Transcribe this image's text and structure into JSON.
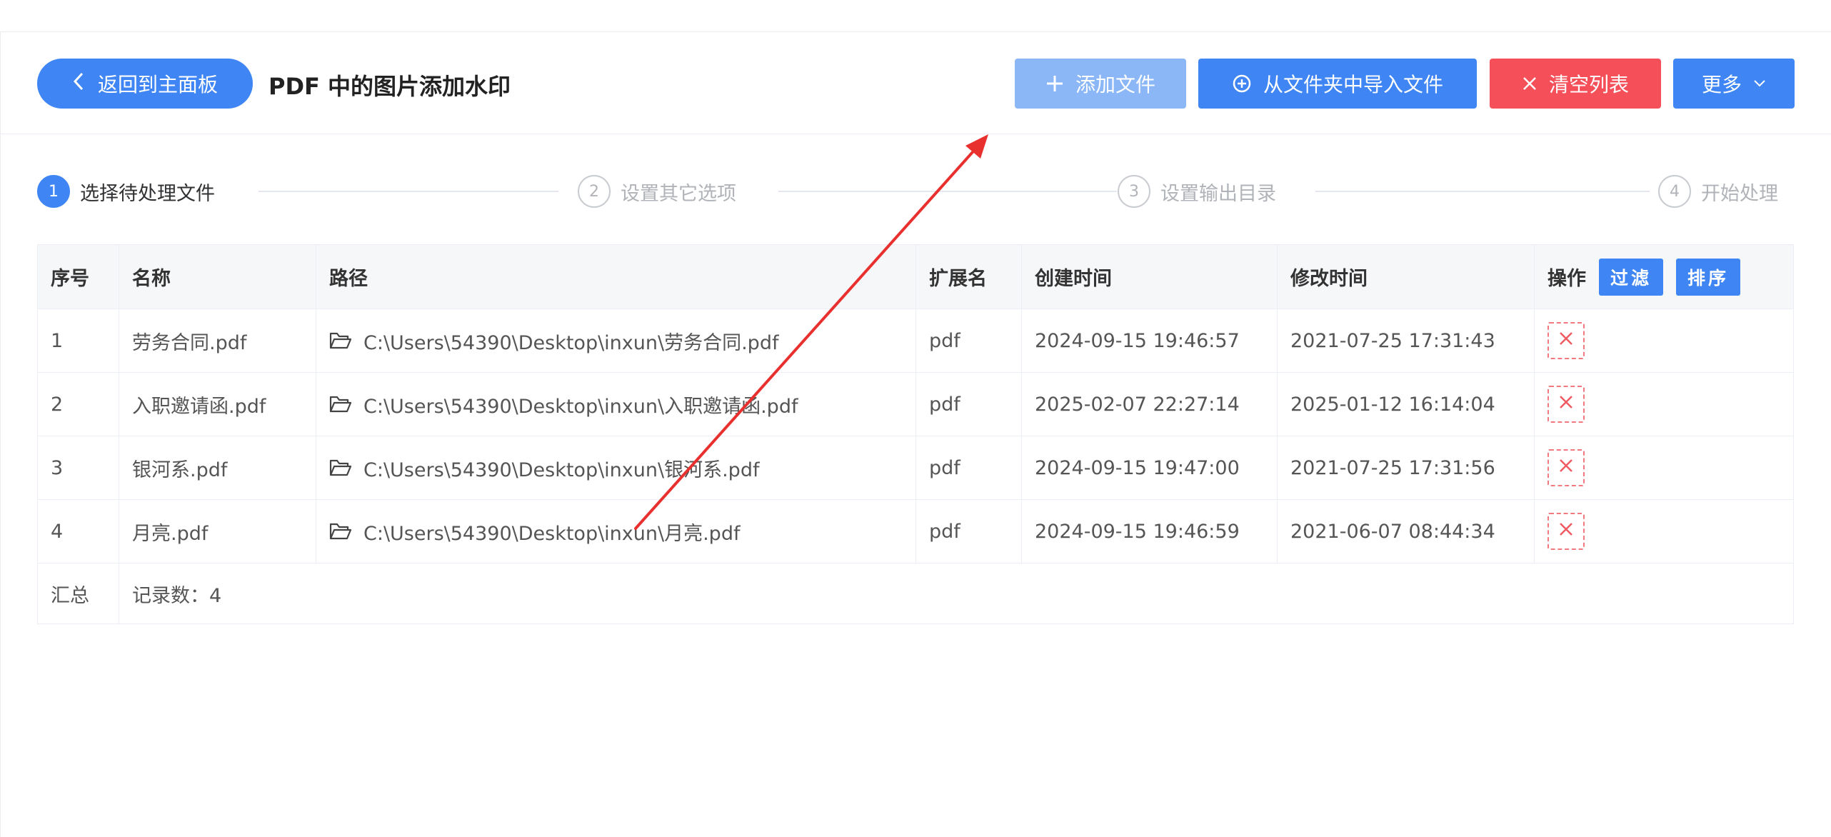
{
  "header": {
    "back_label": "返回到主面板",
    "title": "PDF 中的图片添加水印",
    "add_file_label": "添加文件",
    "import_folder_label": "从文件夹中导入文件",
    "clear_list_label": "清空列表",
    "more_label": "更多"
  },
  "steps": [
    {
      "num": "1",
      "label": "选择待处理文件"
    },
    {
      "num": "2",
      "label": "设置其它选项"
    },
    {
      "num": "3",
      "label": "设置输出目录"
    },
    {
      "num": "4",
      "label": "开始处理"
    }
  ],
  "table": {
    "columns": [
      "序号",
      "名称",
      "路径",
      "扩展名",
      "创建时间",
      "修改时间",
      "操作"
    ],
    "filter_label": "过滤",
    "sort_label": "排序",
    "rows": [
      {
        "index": "1",
        "name": "劳务合同.pdf",
        "path": "C:\\Users\\54390\\Desktop\\inxun\\劳务合同.pdf",
        "ext": "pdf",
        "created": "2024-09-15 19:46:57",
        "modified": "2021-07-25 17:31:43"
      },
      {
        "index": "2",
        "name": "入职邀请函.pdf",
        "path": "C:\\Users\\54390\\Desktop\\inxun\\入职邀请函.pdf",
        "ext": "pdf",
        "created": "2025-02-07 22:27:14",
        "modified": "2025-01-12 16:14:04"
      },
      {
        "index": "3",
        "name": "银河系.pdf",
        "path": "C:\\Users\\54390\\Desktop\\inxun\\银河系.pdf",
        "ext": "pdf",
        "created": "2024-09-15 19:47:00",
        "modified": "2021-07-25 17:31:56"
      },
      {
        "index": "4",
        "name": "月亮.pdf",
        "path": "C:\\Users\\54390\\Desktop\\inxun\\月亮.pdf",
        "ext": "pdf",
        "created": "2024-09-15 19:46:59",
        "modified": "2021-06-07 08:44:34"
      }
    ],
    "summary_label": "汇总",
    "record_count_label": "记录数：4"
  },
  "colors": {
    "primary": "#3f86f4",
    "primary_light": "#8bb7f7",
    "danger": "#f5505a",
    "annotation_arrow": "#e8312f"
  },
  "icons": {
    "back": "chevron-left-icon",
    "add": "plus-icon",
    "import": "circle-plus-icon",
    "clear": "close-icon",
    "more": "chevron-down-icon",
    "path": "folder-open-icon",
    "delete": "close-icon"
  }
}
